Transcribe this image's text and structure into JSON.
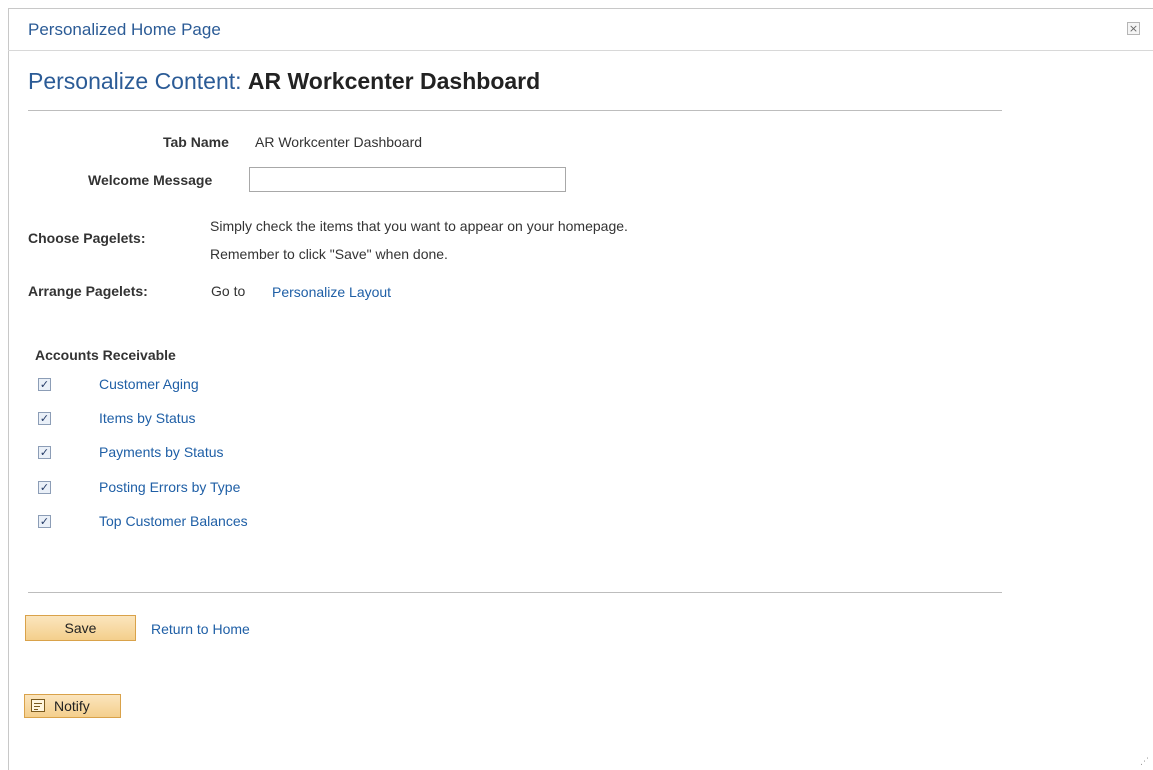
{
  "dialog": {
    "title": "Personalized Home Page",
    "close_glyph": "×"
  },
  "heading": {
    "prefix": "Personalize Content: ",
    "name": "AR Workcenter Dashboard"
  },
  "form": {
    "tab_name_label": "Tab Name",
    "tab_name_value": "AR Workcenter Dashboard",
    "welcome_label": "Welcome Message",
    "welcome_value": "",
    "choose_label": "Choose Pagelets:",
    "choose_text_1": "Simply check the items that you want to appear on your homepage.",
    "choose_text_2": "Remember to click \"Save\" when done.",
    "arrange_label": "Arrange Pagelets:",
    "arrange_goto": "Go to",
    "arrange_link": "Personalize Layout"
  },
  "pagelets": {
    "group_title": "Accounts Receivable",
    "items": [
      {
        "label": "Customer Aging",
        "checked": true
      },
      {
        "label": "Items by Status",
        "checked": true
      },
      {
        "label": "Payments by Status",
        "checked": true
      },
      {
        "label": "Posting Errors by Type",
        "checked": true
      },
      {
        "label": "Top Customer Balances",
        "checked": true
      }
    ],
    "check_glyph": "✓"
  },
  "actions": {
    "save_label": "Save",
    "return_label": "Return to Home",
    "notify_label": "Notify"
  },
  "icons": {
    "close": "close-icon",
    "checkbox": "checkbox-checked-icon",
    "notify": "notify-icon",
    "resize": "resize-grip-icon"
  },
  "colors": {
    "link": "#1f5fa6",
    "title": "#2b5b96",
    "button": "#f4cf8c"
  }
}
